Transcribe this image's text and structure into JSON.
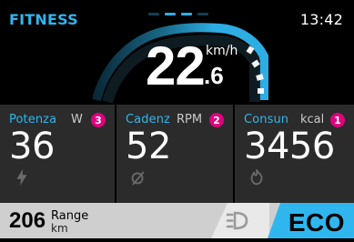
{
  "header": {
    "mode_title": "FITNESS",
    "time": "13:42",
    "page_indicator": {
      "dots": 4
    }
  },
  "speed": {
    "main": "22",
    "decimal": ".6",
    "unit": "km/h"
  },
  "tiles": [
    {
      "label": "Potenza",
      "unit": "W",
      "badge": "3",
      "value": "36",
      "icon": "lightning-icon"
    },
    {
      "label": "Cadenz",
      "unit": "RPM",
      "badge": "2",
      "value": "52",
      "icon": "cadence-icon"
    },
    {
      "label": "Consun",
      "unit": "kcal",
      "badge": "1",
      "value": "3456",
      "icon": "flame-icon"
    }
  ],
  "bottombar": {
    "range_value": "206",
    "range_label": "Range",
    "range_unit": "km",
    "assist_mode": "ECO",
    "headlight_icon": "headlight-icon"
  },
  "colors": {
    "accent": "#2fb6ef",
    "badge": "#e0007e",
    "tile_bg": "#2b2b2b",
    "bottombar_bg": "#cfcfcf"
  }
}
